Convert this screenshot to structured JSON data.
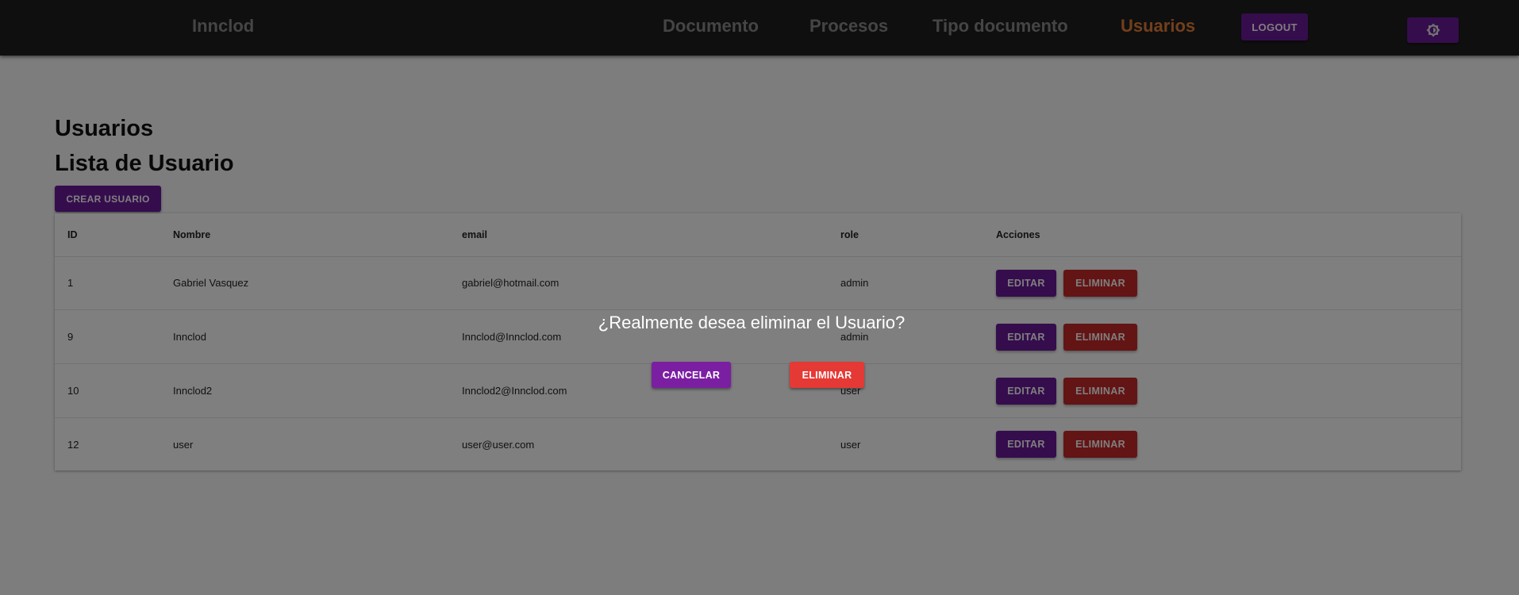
{
  "navbar": {
    "brand": "Innclod",
    "links": [
      {
        "label": "Documento",
        "active": false
      },
      {
        "label": "Procesos",
        "active": false
      },
      {
        "label": "Tipo documento",
        "active": false
      },
      {
        "label": "Usuarios",
        "active": true
      }
    ],
    "logout_label": "LOGOUT",
    "theme_toggle_icon": "brightness-icon"
  },
  "page": {
    "title": "Usuarios",
    "subtitle": "Lista de Usuario",
    "create_label": "CREAR USUARIO"
  },
  "table": {
    "headers": [
      "ID",
      "Nombre",
      "email",
      "role",
      "Acciones"
    ],
    "rows": [
      {
        "id": "1",
        "name": "Gabriel Vasquez",
        "email": "gabriel@hotmail.com",
        "role": "admin"
      },
      {
        "id": "9",
        "name": "Innclod",
        "email": "Innclod@Innclod.com",
        "role": "admin"
      },
      {
        "id": "10",
        "name": "Innclod2",
        "email": "Innclod2@Innclod.com",
        "role": "user"
      },
      {
        "id": "12",
        "name": "user",
        "email": "user@user.com",
        "role": "user"
      }
    ],
    "edit_label": "EDITAR",
    "delete_label": "ELIMINAR"
  },
  "dialog": {
    "message": "¿Realmente desea eliminar el Usuario?",
    "cancel_label": "CANCELAR",
    "confirm_label": "ELIMINAR"
  },
  "colors": {
    "navbar_bg": "#1f1f1f",
    "active_link": "#e57f3a",
    "primary_purple": "#6a1b9a",
    "danger_red": "#c62828",
    "dialog_confirm_red": "#e53935"
  }
}
